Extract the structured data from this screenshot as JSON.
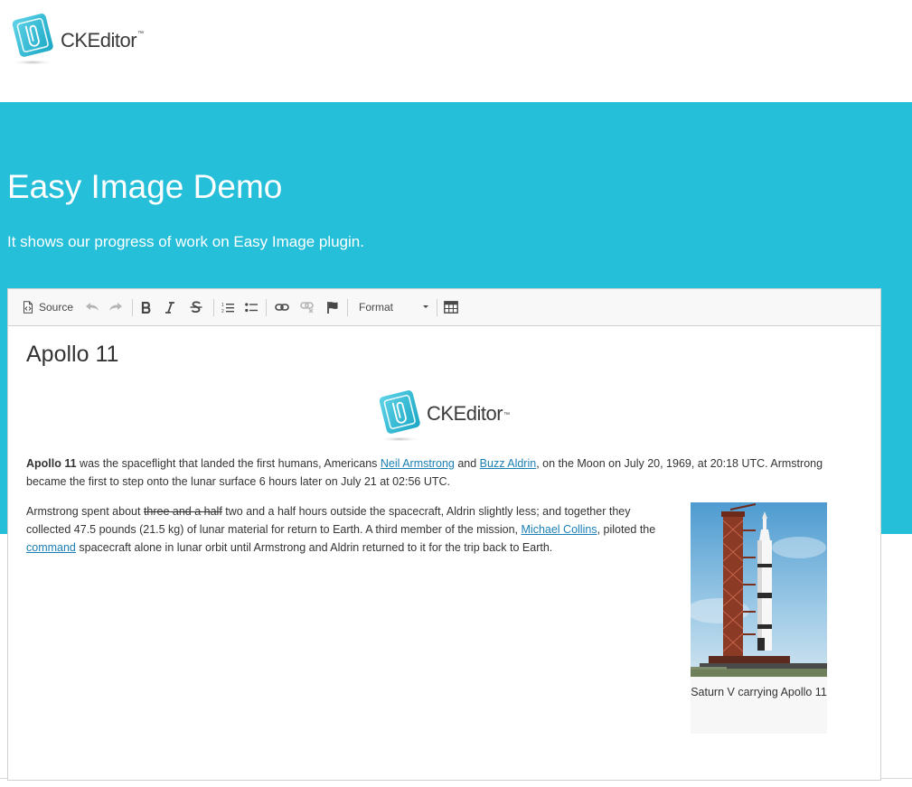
{
  "site": {
    "logo_text": "CKEditor",
    "logo_tm": "™"
  },
  "banner": {
    "title": "Easy Image Demo",
    "subtitle": "It shows our progress of work on Easy Image plugin.",
    "color": "#26bfd9"
  },
  "toolbar": {
    "source_label": "Source",
    "format_label": "Format",
    "icons": [
      "source-icon",
      "undo-icon",
      "redo-icon",
      "bold-icon",
      "italic-icon",
      "strikethrough-icon",
      "numbered-list-icon",
      "bulleted-list-icon",
      "link-icon",
      "unlink-icon",
      "anchor-icon",
      "table-icon"
    ]
  },
  "content": {
    "heading": "Apollo 11",
    "logo_text": "CKEditor",
    "logo_tm": "™",
    "para1": {
      "bold": "Apollo 11",
      "t1": " was the spaceflight that landed the first humans, Americans ",
      "link1": "Neil Armstrong",
      "t2": " and ",
      "link2": "Buzz Aldrin",
      "t3": ", on the Moon on July 20, 1969, at 20:18 UTC. Armstrong became the first to step onto the lunar surface 6 hours later on July 21 at 02:56 UTC."
    },
    "para2": {
      "t1": "Armstrong spent about ",
      "strike": "three and a half",
      "t2": " two and a half hours outside the spacecraft, Aldrin slightly less; and together they collected 47.5 pounds (21.5 kg) of lunar material for return to Earth. A third member of the mission, ",
      "link1": "Michael Collins",
      "t3": ", piloted the ",
      "link2": "command",
      "t4": " spacecraft alone in lunar orbit until Armstrong and Aldrin returned to it for the trip back to Earth."
    },
    "figure": {
      "caption": "Saturn V carrying Apollo 11"
    },
    "link_color": "#1a7fb5"
  }
}
